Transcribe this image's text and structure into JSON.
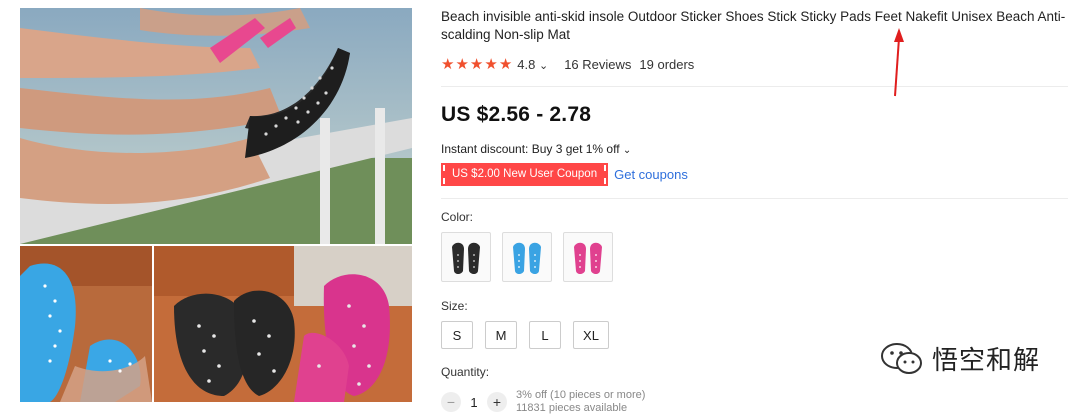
{
  "product": {
    "title": "Beach invisible anti-skid insole Outdoor Sticker Shoes Stick Sticky Pads Feet Nakefit Unisex Beach Anti-scalding Non-slip Mat",
    "rating": "4.8",
    "rating_caret": "⌄",
    "reviews": "16 Reviews",
    "orders": "19 orders",
    "stars": [
      "★",
      "★",
      "★",
      "★",
      "★"
    ],
    "price": "US $2.56 - 2.78",
    "discount_text": "Instant discount: Buy 3 get 1% off",
    "discount_caret": "⌄",
    "coupon_label": "US $2.00 New User Coupon",
    "get_coupons": "Get coupons",
    "color_label": "Color:",
    "colors": [
      "#2b2b2b",
      "#3aa3e3",
      "#e0418f"
    ],
    "size_label": "Size:",
    "sizes": [
      "S",
      "M",
      "L",
      "XL"
    ],
    "quantity_label": "Quantity:",
    "quantity": "1",
    "minus": "−",
    "plus": "+",
    "qty_discount": "3% off (10 pieces or more)",
    "available": "11831 pieces available"
  },
  "watermark": {
    "text": "悟空和解"
  },
  "theme": {
    "accent": "#ff4747",
    "star": "#f0502e",
    "link": "#2e6fdc"
  }
}
